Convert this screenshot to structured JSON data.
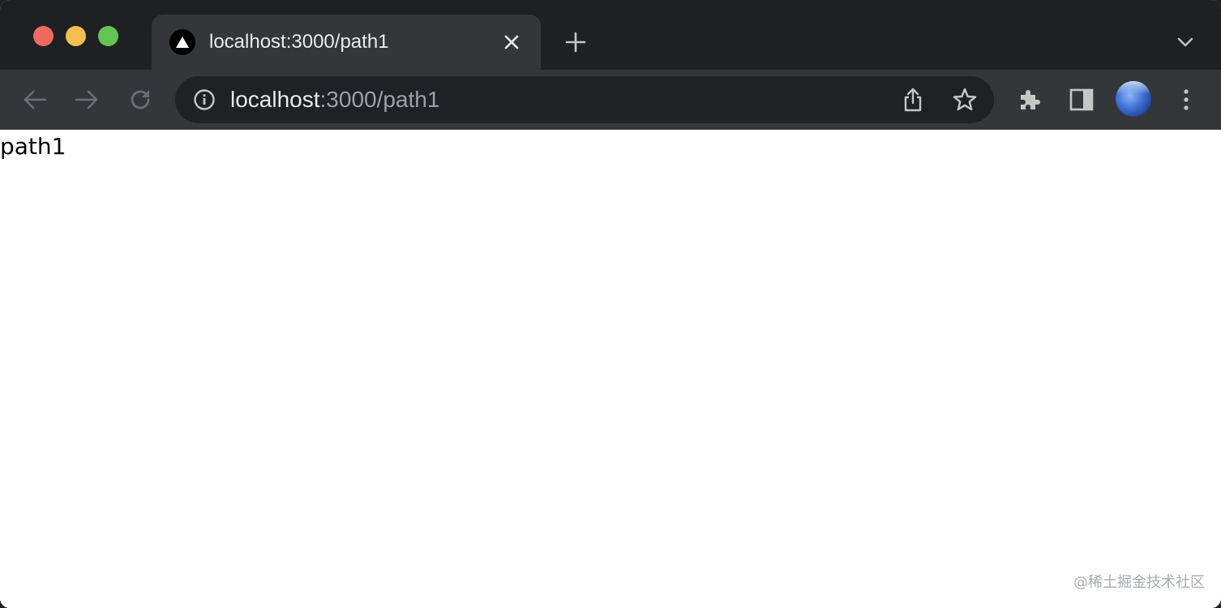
{
  "window": {
    "traffic_lights": {
      "close_color": "#ee6a5f",
      "minimize_color": "#f5be4f",
      "maximize_color": "#62c554"
    }
  },
  "tab": {
    "title": "localhost:3000/path1",
    "favicon": "triangle-icon"
  },
  "toolbar": {
    "url_host": "localhost",
    "url_rest": ":3000/path1"
  },
  "page": {
    "text": "path1"
  },
  "watermark": {
    "text": "@稀土掘金技术社区"
  },
  "colors": {
    "tabstrip_bg": "#1f2023",
    "toolbar_bg": "#35363a",
    "omnibox_bg": "#202124",
    "icon_color": "#c4c7c5",
    "icon_disabled": "#6b6e73"
  }
}
